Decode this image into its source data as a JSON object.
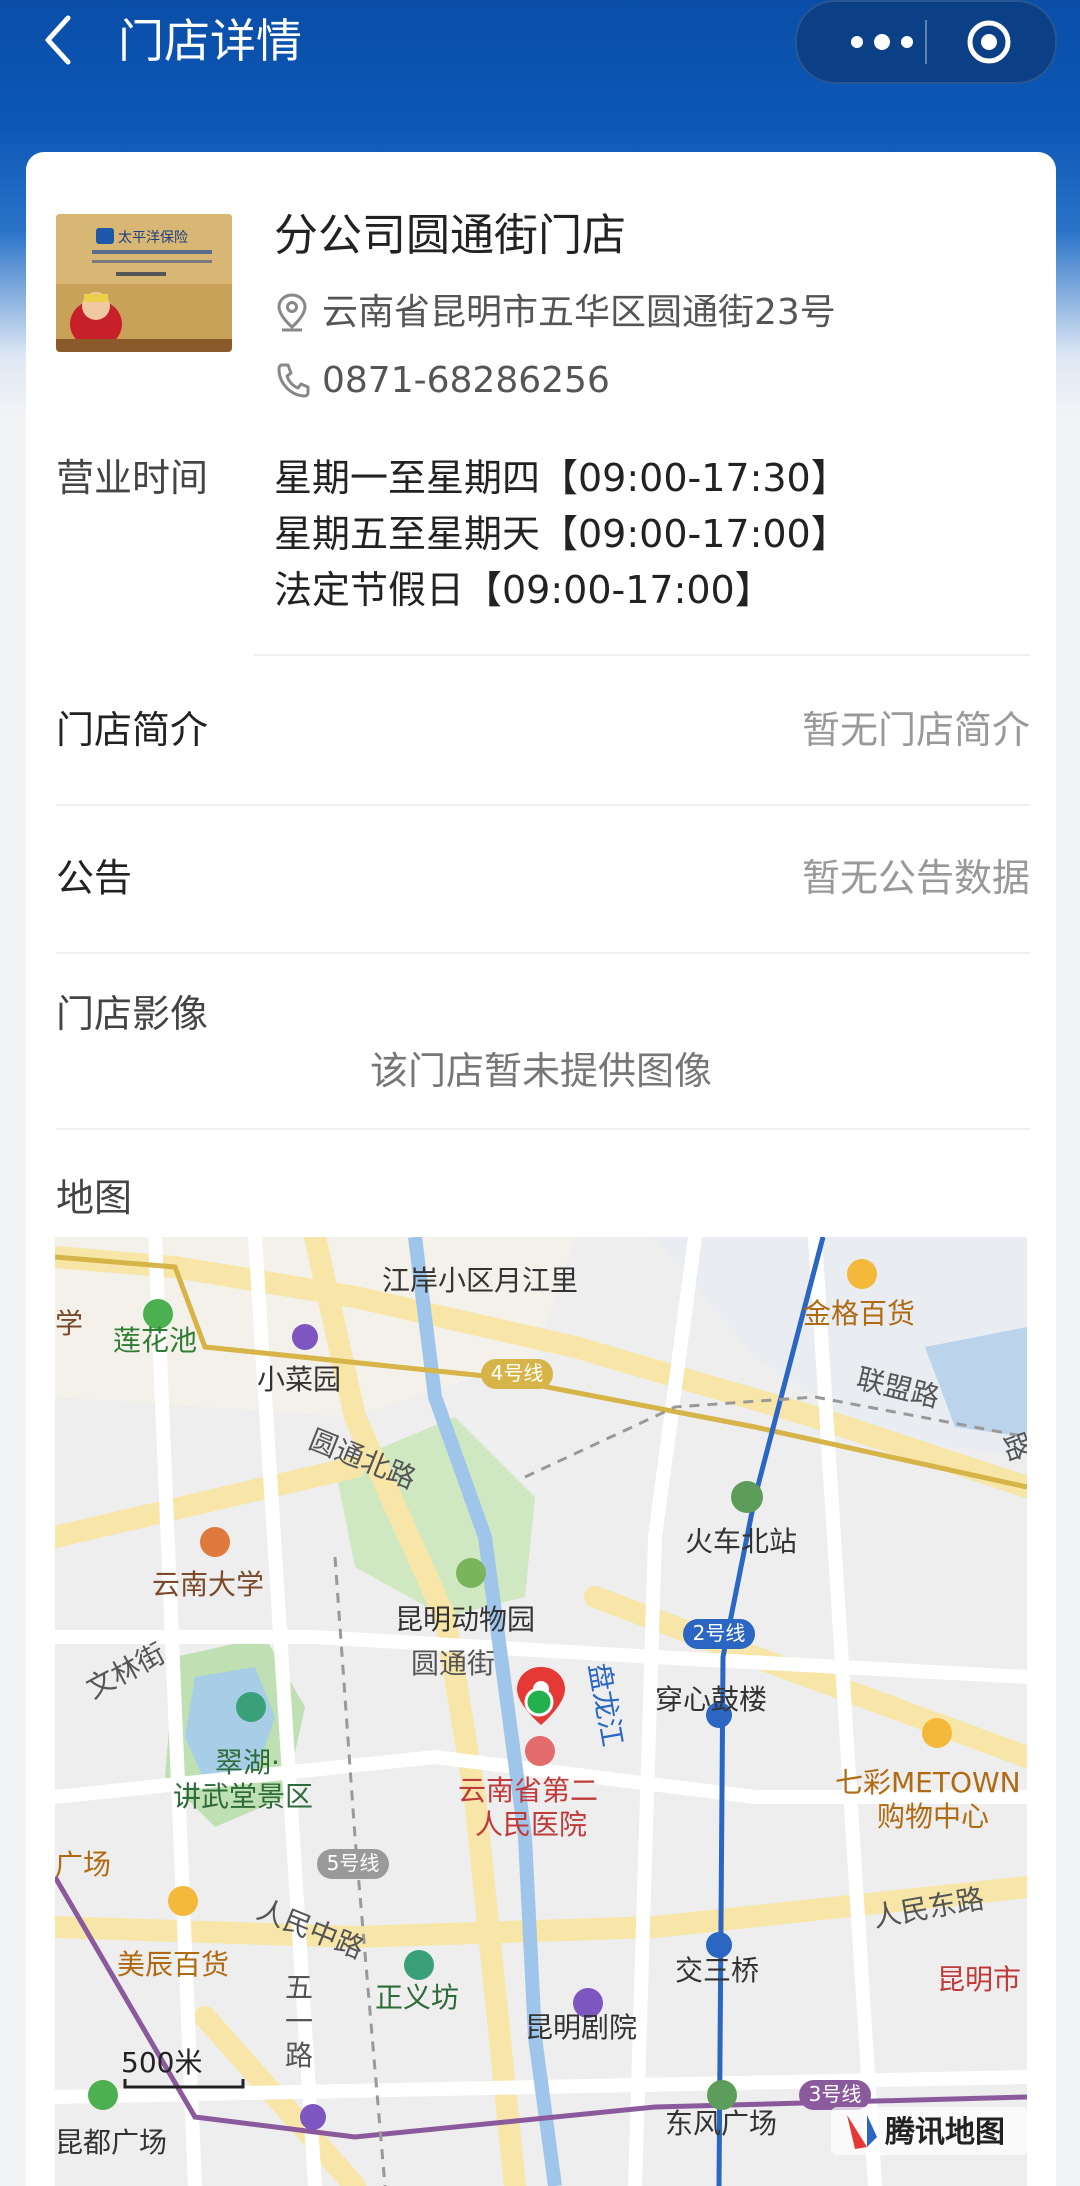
{
  "nav": {
    "title": "门店详情"
  },
  "store": {
    "name": "分公司圆通街门店",
    "address": "云南省昆明市五华区圆通街23号",
    "phone": "0871-68286256",
    "image_sign": "太平洋保险"
  },
  "hours": {
    "label": "营业时间",
    "lines": [
      "星期一至星期四【09:00-17:30】",
      "星期五至星期天【09:00-17:00】",
      "法定节假日【09:00-17:00】"
    ]
  },
  "intro": {
    "label": "门店简介",
    "value": "暂无门店简介"
  },
  "notice": {
    "label": "公告",
    "value": "暂无公告数据"
  },
  "gallery": {
    "label": "门店影像",
    "empty_text": "该门店暂未提供图像"
  },
  "map": {
    "label": "地图",
    "places": {
      "p1": "江岸小区月江里",
      "p2": "金格百货",
      "p3": "莲花池",
      "p4": "小菜园",
      "p5": "联盟路",
      "p6": "圆通北路",
      "p7": "火车北站",
      "p8": "云南大学",
      "p9": "昆明动物园",
      "p10": "文林街",
      "p11": "圆通街",
      "p12": "盘龙江",
      "p13": "穿心鼓楼",
      "p14": "翠湖·",
      "p15": "讲武堂景区",
      "p16": "云南省第二",
      "p17": "人民医院",
      "p18": "七彩METOWN",
      "p19": "购物中心",
      "p20": "广场",
      "p21": "人民中路",
      "p22": "人民东路",
      "p23": "美辰百货",
      "p24": "正义坊",
      "p25": "交三桥",
      "p26": "昆明市",
      "p27": "五",
      "p28": "一",
      "p29": "路",
      "p30": "昆明剧院",
      "p31": "东风广场",
      "p32": "昆都广场",
      "p33": "学",
      "p34": "路"
    },
    "lines": {
      "l4": "4号线",
      "l2": "2号线",
      "l5": "5号线",
      "l3": "3号线"
    },
    "scale": "500米",
    "brand": "腾讯地图"
  }
}
